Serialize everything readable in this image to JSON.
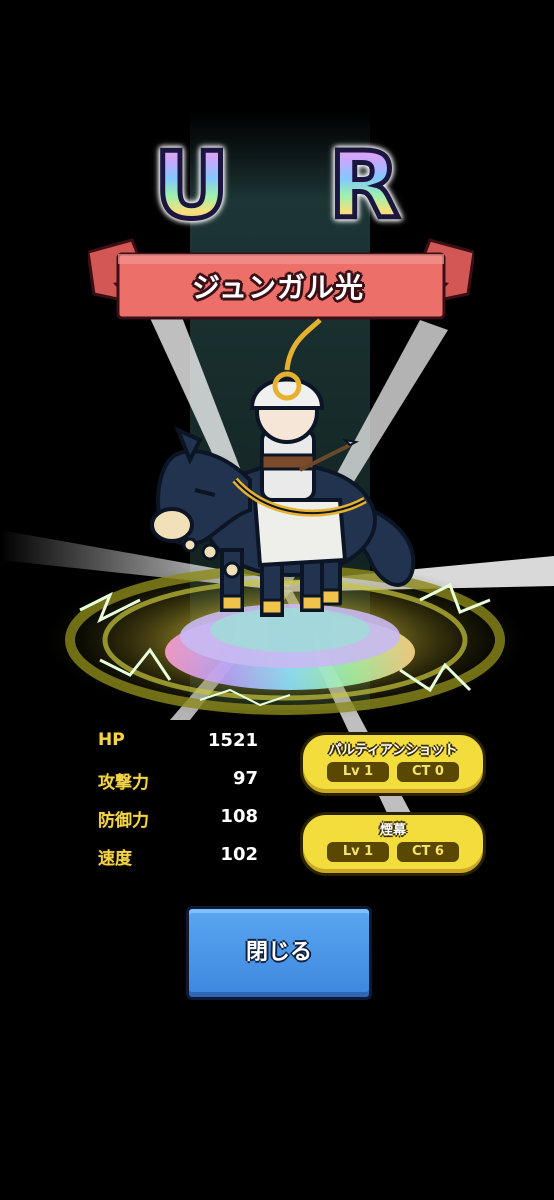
{
  "rarity": {
    "label": "U R"
  },
  "character": {
    "name": "ジュンガル光"
  },
  "stats": [
    {
      "label": "HP",
      "value": "1521"
    },
    {
      "label": "攻撃力",
      "value": "97"
    },
    {
      "label": "防御力",
      "value": "108"
    },
    {
      "label": "速度",
      "value": "102"
    }
  ],
  "skills": [
    {
      "name": "パルティアンショット",
      "level": "Lv 1",
      "ct": "CT 0"
    },
    {
      "name": "煙幕",
      "level": "Lv 1",
      "ct": "CT 6"
    }
  ],
  "close_button": {
    "label": "閉じる"
  },
  "colors": {
    "background": "#000000",
    "banner": "#ec6f6a",
    "stat_label": "#f3d54a",
    "skill_badge": "#f2dd3c",
    "button": "#3e87df"
  }
}
